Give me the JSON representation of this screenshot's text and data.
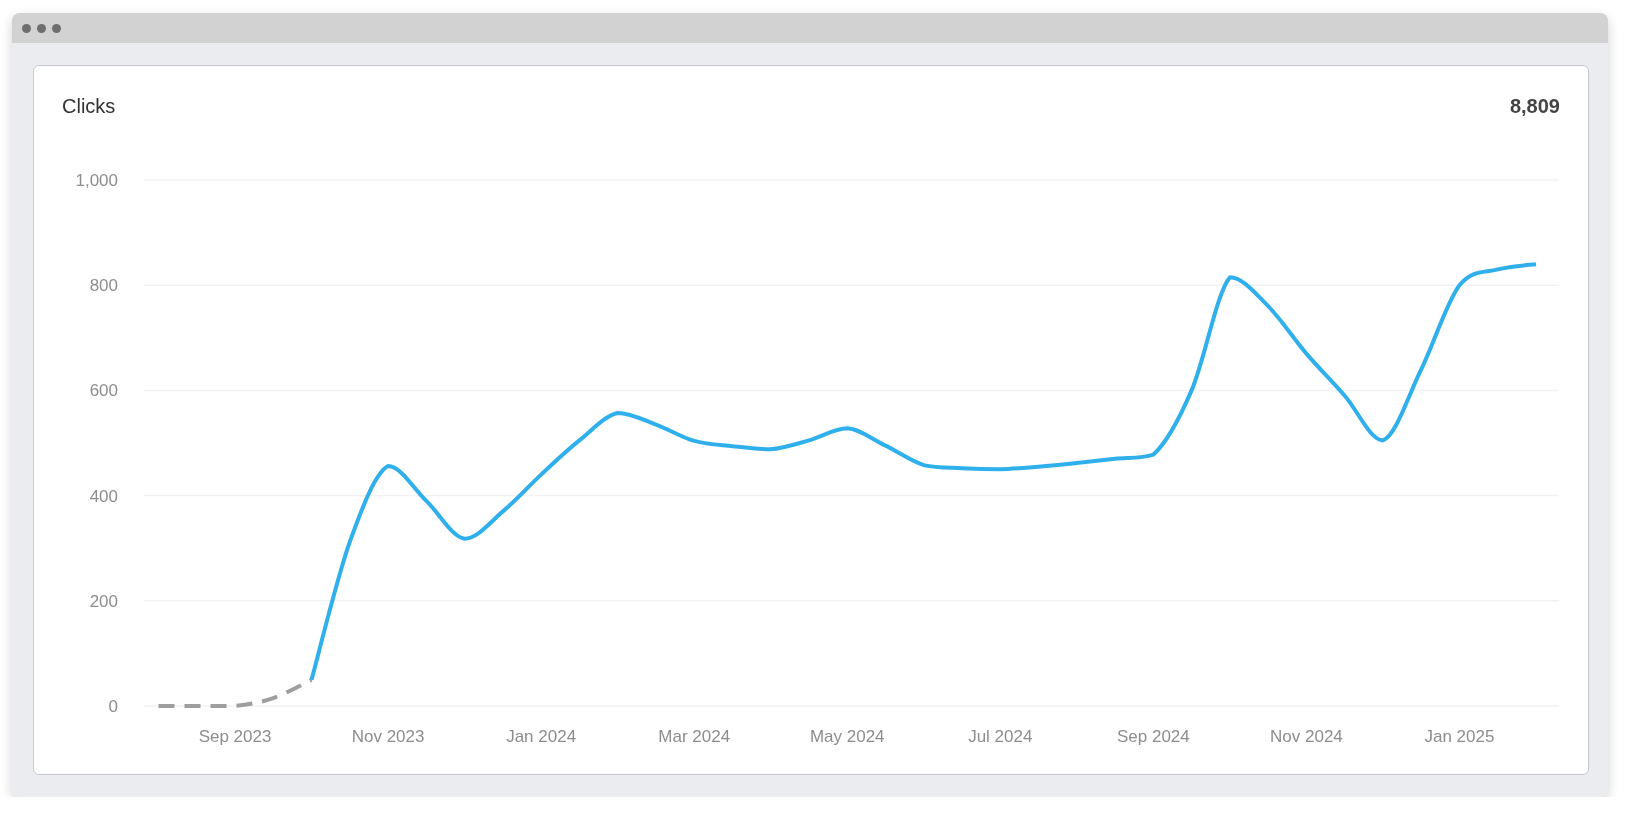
{
  "card": {
    "title": "Clicks",
    "total": "8,809",
    "chart_data": {
      "type": "line",
      "categories": [
        null,
        null,
        "Sep 2023",
        null,
        null,
        null,
        "Nov 2023",
        null,
        null,
        null,
        "Jan 2024",
        null,
        null,
        null,
        "Mar 2024",
        null,
        null,
        null,
        "May 2024",
        null,
        null,
        null,
        "Jul 2024",
        null,
        null,
        null,
        "Sep 2024",
        null,
        null,
        null,
        "Nov 2024",
        null,
        null,
        null,
        "Jan 2025",
        null,
        null
      ],
      "series": [
        {
          "color": "#9e9e9e",
          "line_style": "dashed",
          "values": [
            0,
            0,
            0,
            15,
            50,
            null,
            null,
            null,
            null,
            null,
            null,
            null,
            null,
            null,
            null,
            null,
            null,
            null,
            null,
            null,
            null,
            null,
            null,
            null,
            null,
            null,
            null,
            null,
            null,
            null,
            null,
            null,
            null,
            null,
            null,
            null,
            null
          ]
        },
        {
          "color": "#2fb0ec",
          "line_style": "solid",
          "values": [
            null,
            null,
            null,
            null,
            50,
            312,
            456,
            390,
            318,
            370,
            440,
            505,
            557,
            535,
            504,
            494,
            488,
            505,
            528,
            495,
            458,
            452,
            450,
            455,
            462,
            470,
            478,
            600,
            815,
            760,
            670,
            590,
            505,
            640,
            800,
            830,
            840
          ]
        }
      ],
      "ylim": [
        0,
        1000
      ],
      "grid": true,
      "yticks": [
        {
          "value": 0,
          "label": "0"
        },
        {
          "value": 200,
          "label": "200"
        },
        {
          "value": 400,
          "label": "400"
        },
        {
          "value": 600,
          "label": "600"
        },
        {
          "value": 800,
          "label": "800"
        },
        {
          "value": 1000,
          "label": "1,000"
        }
      ]
    }
  }
}
